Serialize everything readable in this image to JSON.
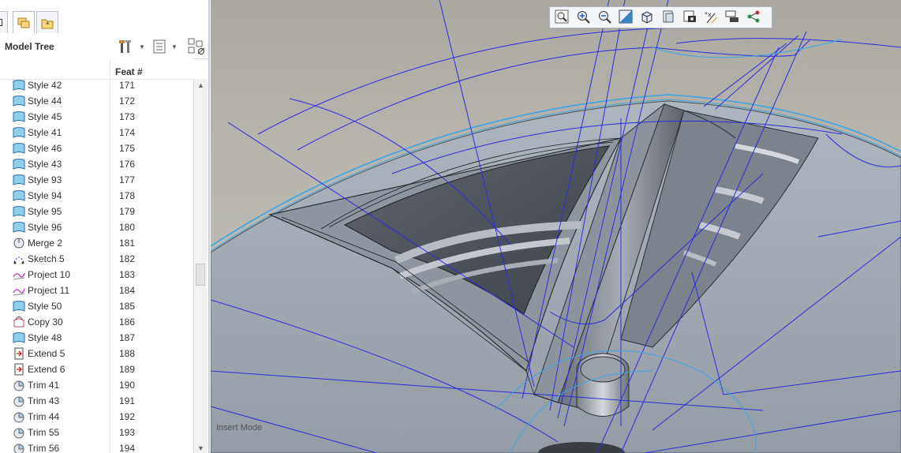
{
  "model_tree": {
    "title": "Model Tree",
    "column_feat": "Feat #",
    "tabs": [
      "model-tree-tab",
      "layers-tab",
      "favorites-tab"
    ],
    "rows": [
      {
        "name": "Style 42",
        "feat": "171",
        "icon": "style-surface-icon"
      },
      {
        "name": "Style 44",
        "feat": "172",
        "icon": "style-surface-icon"
      },
      {
        "name": "Style 45",
        "feat": "173",
        "icon": "style-surface-icon"
      },
      {
        "name": "Style 41",
        "feat": "174",
        "icon": "style-surface-icon"
      },
      {
        "name": "Style 46",
        "feat": "175",
        "icon": "style-surface-icon"
      },
      {
        "name": "Style 43",
        "feat": "176",
        "icon": "style-surface-icon"
      },
      {
        "name": "Style 93",
        "feat": "177",
        "icon": "style-surface-icon"
      },
      {
        "name": "Style 94",
        "feat": "178",
        "icon": "style-surface-icon"
      },
      {
        "name": "Style 95",
        "feat": "179",
        "icon": "style-surface-icon"
      },
      {
        "name": "Style 96",
        "feat": "180",
        "icon": "style-surface-icon"
      },
      {
        "name": "Merge 2",
        "feat": "181",
        "icon": "merge-icon"
      },
      {
        "name": "Sketch 5",
        "feat": "182",
        "icon": "sketch-icon"
      },
      {
        "name": "Project 10",
        "feat": "183",
        "icon": "project-curve-icon"
      },
      {
        "name": "Project 11",
        "feat": "184",
        "icon": "project-curve-icon"
      },
      {
        "name": "Style 50",
        "feat": "185",
        "icon": "style-surface-icon"
      },
      {
        "name": "Copy 30",
        "feat": "186",
        "icon": "copy-surface-icon"
      },
      {
        "name": "Style 48",
        "feat": "187",
        "icon": "style-surface-icon"
      },
      {
        "name": "Extend 5",
        "feat": "188",
        "icon": "extend-icon"
      },
      {
        "name": "Extend 6",
        "feat": "189",
        "icon": "extend-icon"
      },
      {
        "name": "Trim 41",
        "feat": "190",
        "icon": "trim-icon"
      },
      {
        "name": "Trim 43",
        "feat": "191",
        "icon": "trim-icon"
      },
      {
        "name": "Trim 44",
        "feat": "192",
        "icon": "trim-icon"
      },
      {
        "name": "Trim 55",
        "feat": "193",
        "icon": "trim-icon"
      },
      {
        "name": "Trim 56",
        "feat": "194",
        "icon": "trim-icon"
      }
    ]
  },
  "view_toolbar": {
    "buttons": [
      "refit-icon",
      "zoom-in-icon",
      "zoom-out-icon",
      "repaint-icon",
      "display-style-icon",
      "saved-views-icon",
      "view-manager-icon",
      "datum-display-icon",
      "annotation-display-icon",
      "spin-center-icon"
    ]
  },
  "viewport": {
    "status_text": "Insert Mode"
  },
  "colors": {
    "curve_blue": "#2a2ee0",
    "edge_cyan": "#3aa6e6",
    "surface_gray": "#a4acb6"
  }
}
